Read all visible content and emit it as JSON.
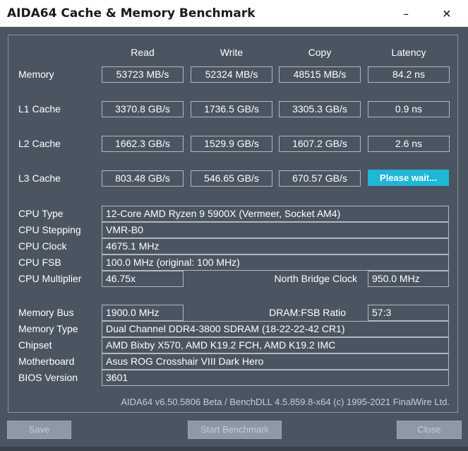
{
  "window": {
    "title": "AIDA64 Cache & Memory Benchmark",
    "minimize_icon": "minimize-icon",
    "close_icon": "close-icon"
  },
  "columns": [
    "Read",
    "Write",
    "Copy",
    "Latency"
  ],
  "rows": [
    {
      "label": "Memory",
      "read": "53723 MB/s",
      "write": "52324 MB/s",
      "copy": "48515 MB/s",
      "latency": "84.2 ns"
    },
    {
      "label": "L1 Cache",
      "read": "3370.8 GB/s",
      "write": "1736.5 GB/s",
      "copy": "3305.3 GB/s",
      "latency": "0.9 ns"
    },
    {
      "label": "L2 Cache",
      "read": "1662.3 GB/s",
      "write": "1529.9 GB/s",
      "copy": "1607.2 GB/s",
      "latency": "2.6 ns"
    },
    {
      "label": "L3 Cache",
      "read": "803.48 GB/s",
      "write": "546.65 GB/s",
      "copy": "670.57 GB/s",
      "latency": "Please wait..."
    }
  ],
  "info": {
    "cpu_type_label": "CPU Type",
    "cpu_type": "12-Core AMD Ryzen 9 5900X  (Vermeer, Socket AM4)",
    "cpu_stepping_label": "CPU Stepping",
    "cpu_stepping": "VMR-B0",
    "cpu_clock_label": "CPU Clock",
    "cpu_clock": "4675.1 MHz",
    "cpu_fsb_label": "CPU FSB",
    "cpu_fsb": "100.0 MHz  (original: 100 MHz)",
    "cpu_multiplier_label": "CPU Multiplier",
    "cpu_multiplier": "46.75x",
    "nb_clock_label": "North Bridge Clock",
    "nb_clock": "950.0 MHz",
    "memory_bus_label": "Memory Bus",
    "memory_bus": "1900.0 MHz",
    "dram_fsb_label": "DRAM:FSB Ratio",
    "dram_fsb": "57:3",
    "memory_type_label": "Memory Type",
    "memory_type": "Dual Channel DDR4-3800 SDRAM  (18-22-22-42 CR1)",
    "chipset_label": "Chipset",
    "chipset": "AMD Bixby X570, AMD K19.2 FCH, AMD K19.2 IMC",
    "motherboard_label": "Motherboard",
    "motherboard": "Asus ROG Crosshair VIII Dark Hero",
    "bios_label": "BIOS Version",
    "bios": "3601"
  },
  "footer": "AIDA64 v6.50.5806 Beta / BenchDLL 4.5.859.8-x64  (c) 1995-2021 FinalWire Ltd.",
  "buttons": {
    "save": "Save",
    "start": "Start Benchmark",
    "close": "Close"
  },
  "colors": {
    "background": "#4b5561",
    "accent": "#1fb7d8"
  }
}
